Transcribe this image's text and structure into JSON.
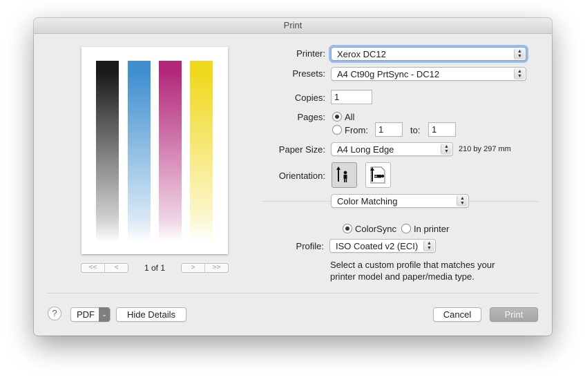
{
  "window": {
    "title": "Print"
  },
  "preview": {
    "page_indicator": "1 of 1",
    "nav_first": "<<",
    "nav_prev": "<",
    "nav_next": ">",
    "nav_last": ">>",
    "bar_colors": [
      "#1a1a1a",
      "#3f8ed0",
      "#b3287b",
      "#f0d81c"
    ]
  },
  "form": {
    "printer_label": "Printer:",
    "printer_value": "Xerox DC12",
    "presets_label": "Presets:",
    "presets_value": "A4 Ct90g PrtSync - DC12",
    "copies_label": "Copies:",
    "copies_value": "1",
    "pages_label": "Pages:",
    "pages_all": "All",
    "pages_from": "From:",
    "pages_from_value": "1",
    "pages_to": "to:",
    "pages_to_value": "1",
    "paper_size_label": "Paper Size:",
    "paper_size_value": "A4 Long Edge",
    "paper_size_dims": "210 by 297 mm",
    "orientation_label": "Orientation:",
    "section_value": "Color Matching",
    "colorsync": "ColorSync",
    "in_printer": "In printer",
    "profile_label": "Profile:",
    "profile_value": "ISO Coated v2 (ECI)",
    "hint_line1": "Select a custom profile that matches your",
    "hint_line2": "printer model and paper/media type."
  },
  "footer": {
    "help": "?",
    "pdf": "PDF",
    "hide_details": "Hide Details",
    "cancel": "Cancel",
    "print": "Print"
  }
}
